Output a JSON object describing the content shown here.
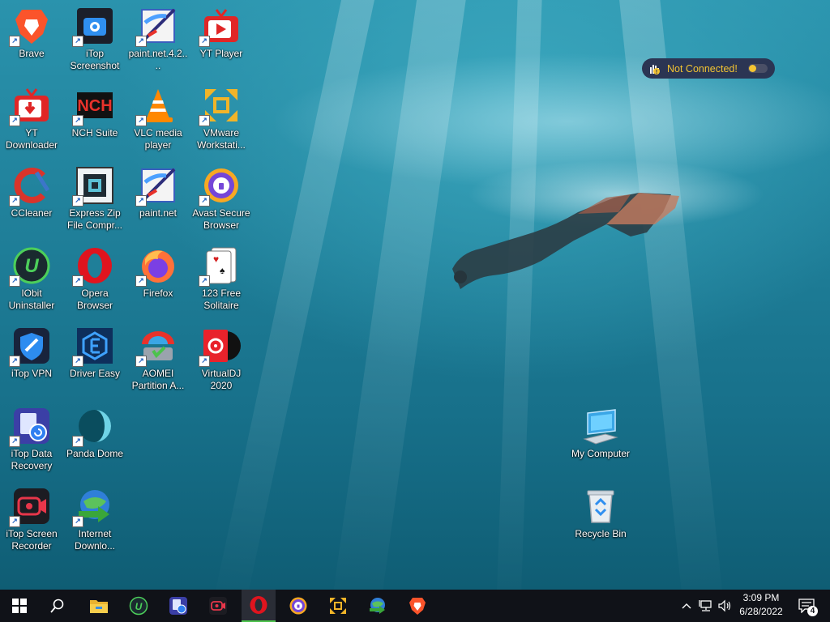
{
  "desktop_icons": [
    {
      "label": "Brave",
      "icon": "brave-icon"
    },
    {
      "label": "iTop Screenshot",
      "icon": "itop-screenshot-icon"
    },
    {
      "label": "paint.net.4.2....",
      "icon": "paintnet-icon"
    },
    {
      "label": "YT Player",
      "icon": "yt-player-icon"
    },
    {
      "label": "YT Downloader",
      "icon": "yt-downloader-icon"
    },
    {
      "label": "NCH Suite",
      "icon": "nch-suite-icon"
    },
    {
      "label": "VLC media player",
      "icon": "vlc-icon"
    },
    {
      "label": "VMware Workstati...",
      "icon": "vmware-icon"
    },
    {
      "label": "CCleaner",
      "icon": "ccleaner-icon"
    },
    {
      "label": "Express Zip File Compr...",
      "icon": "express-zip-icon"
    },
    {
      "label": "paint.net",
      "icon": "paintnet-icon"
    },
    {
      "label": "Avast Secure Browser",
      "icon": "avast-browser-icon"
    },
    {
      "label": "IObit Uninstaller",
      "icon": "iobit-uninstaller-icon"
    },
    {
      "label": "Opera Browser",
      "icon": "opera-icon"
    },
    {
      "label": "Firefox",
      "icon": "firefox-icon"
    },
    {
      "label": "123 Free Solitaire",
      "icon": "solitaire-icon"
    },
    {
      "label": "iTop VPN",
      "icon": "itop-vpn-icon"
    },
    {
      "label": "Driver Easy",
      "icon": "driver-easy-icon"
    },
    {
      "label": "AOMEI Partition A...",
      "icon": "aomei-icon"
    },
    {
      "label": "VirtualDJ 2020",
      "icon": "virtualdj-icon"
    },
    {
      "label": "iTop Data Recovery",
      "icon": "itop-data-recovery-icon"
    },
    {
      "label": "Panda Dome",
      "icon": "panda-dome-icon"
    },
    {
      "label": "iTop Screen Recorder",
      "icon": "itop-screen-recorder-icon"
    },
    {
      "label": "Internet Downlo...",
      "icon": "idm-icon"
    },
    {
      "label": "My Computer",
      "icon": "my-computer-icon"
    },
    {
      "label": "Recycle Bin",
      "icon": "recycle-bin-icon"
    }
  ],
  "vpn_widget": {
    "status": "Not Connected!",
    "status_color": "#f3c432"
  },
  "taskbar": {
    "pinned": [
      "file-explorer-icon",
      "iobit-uninstaller-icon",
      "itop-data-recovery-icon",
      "itop-screen-recorder-icon",
      "opera-icon",
      "avast-browser-icon",
      "vmware-icon",
      "idm-icon",
      "brave-icon"
    ],
    "active_app": "opera-icon",
    "clock": {
      "time": "3:09 PM",
      "date": "6/28/2022"
    },
    "notification_count": "4"
  }
}
